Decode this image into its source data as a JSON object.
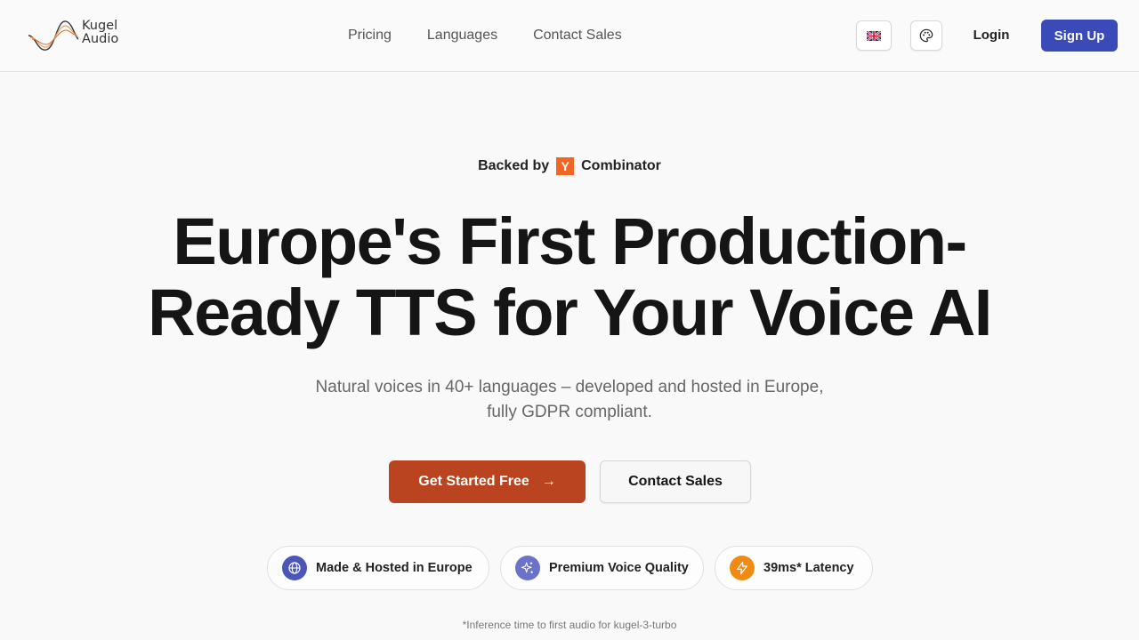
{
  "header": {
    "logo_line1": "Kugel",
    "logo_line2": "Audio",
    "nav": [
      "Pricing",
      "Languages",
      "Contact Sales"
    ],
    "login_label": "Login",
    "signup_label": "Sign Up"
  },
  "hero": {
    "backed_prefix": "Backed by",
    "yc_letter": "Y",
    "backed_suffix": "Combinator",
    "headline_line1": "Europe's First Production-",
    "headline_line2": "Ready TTS for Your Voice AI",
    "subtitle_line1": "Natural voices in 40+ languages – developed and hosted in Europe,",
    "subtitle_line2": "fully GDPR compliant.",
    "cta_primary": "Get Started Free",
    "cta_primary_arrow": "→",
    "cta_secondary": "Contact Sales"
  },
  "features": [
    {
      "label": "Made & Hosted in Europe",
      "icon": "globe-icon",
      "color": "#4a57b8"
    },
    {
      "label": "Premium Voice Quality",
      "icon": "sparkles-icon",
      "color": "#6b73c9"
    },
    {
      "label": "39ms* Latency",
      "icon": "lightning-icon",
      "color": "#f08a12"
    }
  ],
  "footnote": "*Inference time to first audio for kugel-3-turbo",
  "colors": {
    "signup": "#3a4bb8",
    "cta_primary": "#bb4420",
    "yc": "#f26522"
  }
}
